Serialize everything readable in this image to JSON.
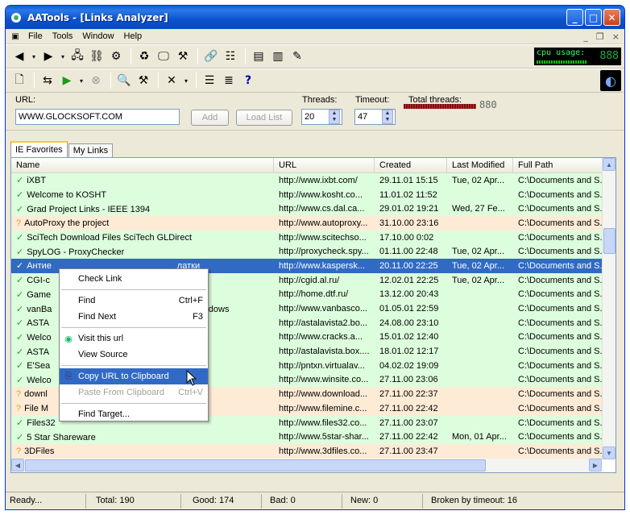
{
  "window": {
    "title": "AATools - [Links Analyzer]"
  },
  "menu": {
    "items": [
      "File",
      "Tools",
      "Window",
      "Help"
    ],
    "right_controls": [
      "_",
      "×"
    ]
  },
  "cpu": {
    "label": "cpu usage:",
    "digits": "888"
  },
  "form": {
    "url_label": "URL:",
    "url_value": "WWW.GLOCKSOFT.COM",
    "add_button": "Add",
    "load_list_button": "Load List",
    "threads_label": "Threads:",
    "threads_value": "20",
    "timeout_label": "Timeout:",
    "timeout_value": "47",
    "total_threads_label": "Total threads:",
    "total_threads_value": "880"
  },
  "tabs": [
    "IE Favorites",
    "My Links"
  ],
  "columns": [
    "Name",
    "URL",
    "Created",
    "Last Modified",
    "Full Path"
  ],
  "rows": [
    {
      "status": "good",
      "name": "iXBT",
      "url": "http://www.ixbt.com/",
      "created": "29.11.01 15:15",
      "modified": "Tue, 02 Apr...",
      "path": "C:\\Documents and S..."
    },
    {
      "status": "good",
      "name": "Welcome to KOSHT",
      "url": "http://www.kosht.co...",
      "created": "11.01.02 11:52",
      "modified": "",
      "path": "C:\\Documents and S..."
    },
    {
      "status": "good",
      "name": "Grad Project Links - IEEE 1394",
      "url": "http://www.cs.dal.ca...",
      "created": "29.01.02 19:21",
      "modified": "Wed, 27 Fe...",
      "path": "C:\\Documents and S..."
    },
    {
      "status": "warn",
      "name": "AutoProxy the project",
      "url": "http://www.autoproxy...",
      "created": "31.10.00 23:16",
      "modified": "",
      "path": "C:\\Documents and S..."
    },
    {
      "status": "good",
      "name": "SciTech Download Files SciTech GLDirect",
      "url": "http://www.scitechso...",
      "created": "17.10.00 0:02",
      "modified": "",
      "path": "C:\\Documents and S..."
    },
    {
      "status": "good",
      "name": "SpyLOG - ProxyChecker",
      "url": "http://proxycheck.spy...",
      "created": "01.11.00 22:48",
      "modified": "Tue, 02 Apr...",
      "path": "C:\\Documents and S..."
    },
    {
      "status": "sel",
      "name": "Антие                                                   латки",
      "url": "http://www.kaspersk...",
      "created": "20.11.00 22:25",
      "modified": "Tue, 02 Apr...",
      "path": "C:\\Documents and S..."
    },
    {
      "status": "good",
      "name": "CGI-c",
      "url": "http://cgid.al.ru/",
      "created": "12.02.01 22:25",
      "modified": "Tue, 02 Apr...",
      "path": "C:\\Documents and S..."
    },
    {
      "status": "good",
      "name": "Game",
      "url": "http://home.dtf.ru/",
      "created": "13.12.00 20:43",
      "modified": "",
      "path": "C:\\Documents and S..."
    },
    {
      "status": "good",
      "name": "vanBa                                              are for Windows",
      "url": "http://www.vanbasco...",
      "created": "01.05.01 22:59",
      "modified": "",
      "path": "C:\\Documents and S..."
    },
    {
      "status": "good",
      "name": "ASTA",
      "url": "http://astalavista2.bo...",
      "created": "24.08.00 23:10",
      "modified": "",
      "path": "C:\\Documents and S..."
    },
    {
      "status": "good",
      "name": "Welco",
      "url": "http://www.cracks.a...",
      "created": "15.01.02 12:40",
      "modified": "",
      "path": "C:\\Documents and S..."
    },
    {
      "status": "good",
      "name": "ASTA",
      "url": "http://astalavista.box....",
      "created": "18.01.02 12:17",
      "modified": "",
      "path": "C:\\Documents and S..."
    },
    {
      "status": "good",
      "name": "E'Sea",
      "url": "http://pntxn.virtualav...",
      "created": "04.02.02 19:09",
      "modified": "",
      "path": "C:\\Documents and S..."
    },
    {
      "status": "good",
      "name": "Welco",
      "url": "http://www.winsite.co...",
      "created": "27.11.00 23:06",
      "modified": "",
      "path": "C:\\Documents and S..."
    },
    {
      "status": "warn",
      "name": "downl",
      "url": "http://www.download...",
      "created": "27.11.00 22:37",
      "modified": "",
      "path": "C:\\Documents and S..."
    },
    {
      "status": "warn",
      "name": "File M",
      "url": "http://www.filemine.c...",
      "created": "27.11.00 22:42",
      "modified": "",
      "path": "C:\\Documents and S..."
    },
    {
      "status": "good",
      "name": "Files32",
      "url": "http://www.files32.co...",
      "created": "27.11.00 23:07",
      "modified": "",
      "path": "C:\\Documents and S..."
    },
    {
      "status": "good",
      "name": "5 Star Shareware",
      "url": "http://www.5star-shar...",
      "created": "27.11.00 22:42",
      "modified": "Mon, 01 Apr...",
      "path": "C:\\Documents and S..."
    },
    {
      "status": "warn",
      "name": "3DFiles",
      "url": "http://www.3dfiles.co...",
      "created": "27.11.00 23:47",
      "modified": "",
      "path": "C:\\Documents and S..."
    }
  ],
  "context_menu": [
    {
      "label": "Check Link",
      "shortcut": "",
      "icon": "",
      "state": "normal"
    },
    {
      "sep": true
    },
    {
      "label": "Find",
      "shortcut": "Ctrl+F",
      "icon": "",
      "state": "normal"
    },
    {
      "label": "Find Next",
      "shortcut": "F3",
      "icon": "",
      "state": "normal"
    },
    {
      "sep": true
    },
    {
      "label": "Visit this url",
      "shortcut": "",
      "icon": "browser-icon",
      "state": "normal"
    },
    {
      "label": "View Source",
      "shortcut": "",
      "icon": "",
      "state": "normal"
    },
    {
      "sep": true
    },
    {
      "label": "Copy URL to Clipboard",
      "shortcut": "",
      "icon": "copy-icon",
      "state": "highlighted"
    },
    {
      "label": "Paste From Clipboard",
      "shortcut": "Ctrl+V",
      "icon": "",
      "state": "disabled"
    },
    {
      "sep": true
    },
    {
      "label": "Find Target...",
      "shortcut": "",
      "icon": "",
      "state": "normal"
    }
  ],
  "status": {
    "ready": "Ready...",
    "total": "Total: 190",
    "good": "Good: 174",
    "bad": "Bad: 0",
    "new": "New: 0",
    "broken": "Broken by timeout: 16"
  },
  "colors": {
    "good_row": "#ddfedd",
    "warn_row": "#fdebd6",
    "selection": "#316ac5",
    "title_bar": "#0b53cd"
  }
}
